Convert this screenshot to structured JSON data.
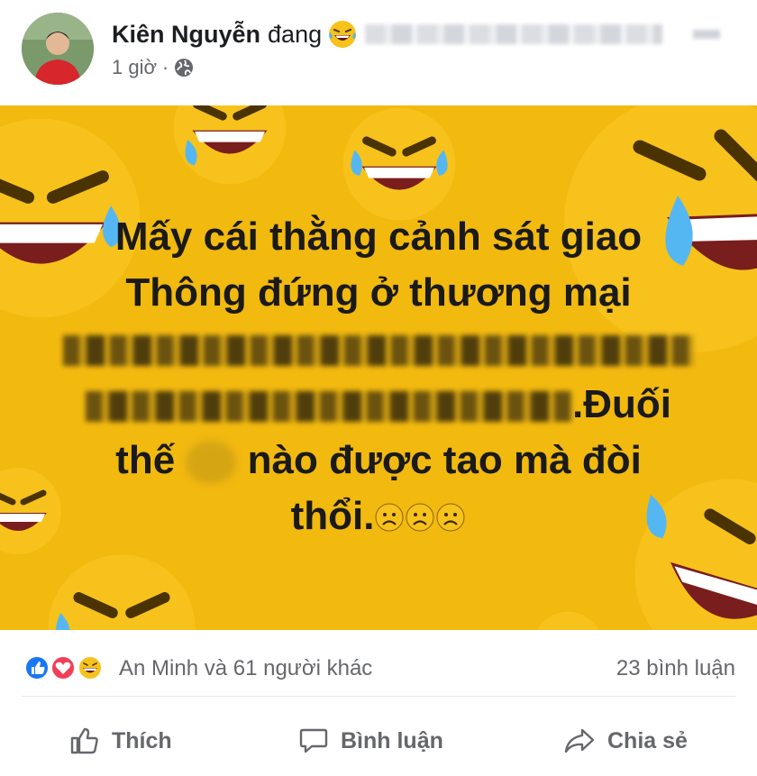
{
  "post": {
    "author_name": "Kiên Nguyễn",
    "status_verb": "đang",
    "timestamp": "1 giờ",
    "separator": "·",
    "privacy_icon": "globe-icon",
    "feeling_icon": "laughing-tears-emoji-icon"
  },
  "image_text": {
    "line1": "Mấy cái thằng cảnh sát giao",
    "line2": "Thông đứng ở thương mại",
    "line4_end": ".Đuối",
    "line5_start": "thế",
    "line5_end": "nào được tao mà đòi",
    "line6": "thổi.",
    "sad_emoji_icons": [
      "frowning-face-icon",
      "frowning-face-icon",
      "frowning-face-icon"
    ]
  },
  "reactions": {
    "icons": [
      "like-reaction-icon",
      "love-reaction-icon",
      "haha-reaction-icon"
    ],
    "summary": "An Minh và 61 người khác",
    "comments": "23 bình luận"
  },
  "actions": {
    "like": "Thích",
    "comment": "Bình luận",
    "share": "Chia sẻ"
  },
  "colors": {
    "background_yellow": "#f2b90f",
    "emoji_yellow": "#f7c21b",
    "text_gray": "#65676b",
    "like_blue": "#1877f2",
    "love_red": "#f33e58"
  }
}
